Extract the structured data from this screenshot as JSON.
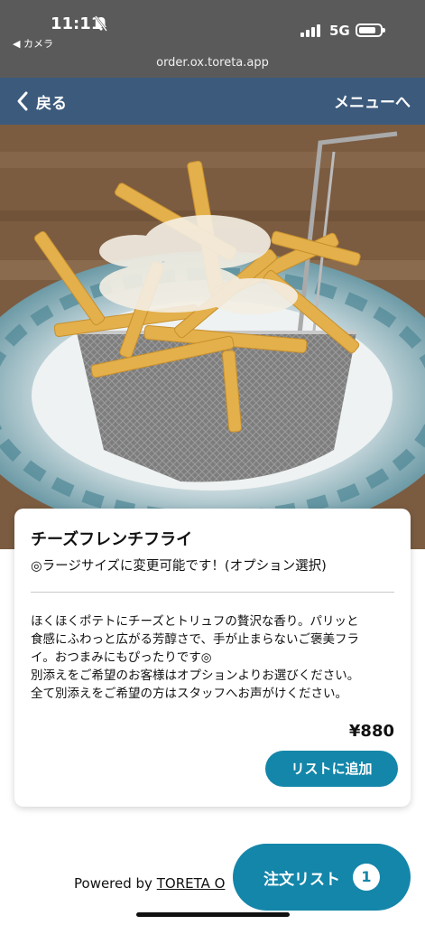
{
  "status_bar": {
    "time": "11:11",
    "back_app": "◀ カメラ",
    "network": "5G",
    "url": "order.ox.toreta.app"
  },
  "header": {
    "back_label": "戻る",
    "menu_label": "メニューへ",
    "background": "#3b5a7c"
  },
  "item": {
    "name": "チーズフレンチフライ",
    "subtitle": "◎ラージサイズに変更可能です！(オプション選択)",
    "description": [
      "ほくほくポテトにチーズとトリュフの贅沢な香り。パリッと",
      "食感にふわっと広がる芳醇さで、手が止まらないご褒美フラ",
      "イ。おつまみにもぴったりです◎",
      "別添えをご希望のお客様はオプションよりお選びください。",
      "全て別添えをご希望の方はスタッフへお声がけください。"
    ],
    "price": "¥880",
    "add_button": "リストに追加"
  },
  "footer": {
    "powered_prefix": "Powered by ",
    "powered_link": "TORETA O"
  },
  "order_button": {
    "label": "注文リスト",
    "count": "1",
    "accent": "#1486a9"
  },
  "icons": [
    "bell-off-icon",
    "signal-icon",
    "battery-icon",
    "chevron-left-icon"
  ]
}
